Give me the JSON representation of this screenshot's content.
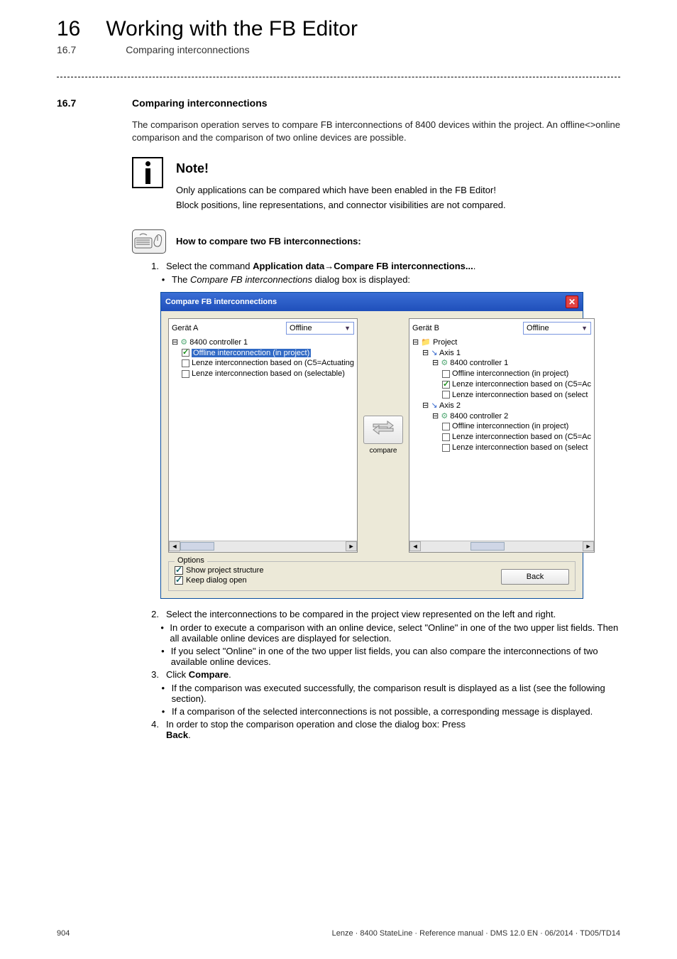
{
  "header": {
    "chapter_num": "16",
    "chapter_title": "Working with the FB Editor",
    "section_ref": "16.7",
    "section_ref_title": "Comparing interconnections"
  },
  "section": {
    "num": "16.7",
    "title": "Comparing interconnections",
    "intro": "The comparison operation serves to compare FB interconnections of 8400 devices within the project. An offline<>online comparison and the comparison of two online devices are possible."
  },
  "note": {
    "title": "Note!",
    "line1": "Only applications can be compared which have been enabled in the FB Editor!",
    "line2": "Block positions, line representations, and connector visibilities are not compared."
  },
  "howto": {
    "label": "How to compare two FB interconnections:"
  },
  "steps": {
    "s1_pre": "Select the command ",
    "s1_b1": "Application data",
    "s1_arrow": "→",
    "s1_b2": "Compare FB interconnections...",
    "s1_post": ".",
    "s1_bullet_pre": "The ",
    "s1_bullet_i": "Compare FB interconnections",
    "s1_bullet_post": " dialog box is displayed:",
    "s2": "Select the interconnections to be compared in the project view represented on the left and right.",
    "s2_b1": "In order to execute a comparison with an online device, select \"Online\" in one of the two upper list fields. Then all available online devices are displayed for selection.",
    "s2_b2": "If you select \"Online\" in one of the two upper list fields, you can also compare the interconnections of two available online devices.",
    "s3_pre": "Click ",
    "s3_b": "Compare",
    "s3_post": ".",
    "s3_b1": "If the comparison was executed successfully, the comparison result is displayed as a list (see the following section).",
    "s3_b2": "If a comparison of the selected interconnections is not possible, a corresponding message is displayed.",
    "s4_pre": "In order to stop the comparison operation and close the dialog box: Press ",
    "s4_b": "Back",
    "s4_post": "."
  },
  "dialog": {
    "title": "Compare FB interconnections",
    "geratA": "Gerät A",
    "geratB": "Gerät B",
    "offline": "Offline",
    "compare_btn": "compare",
    "treeA": {
      "root": "8400 controller 1",
      "i1": "Offline interconnection (in project)",
      "i2": "Lenze interconnection based on (C5=Actuating",
      "i3": "Lenze interconnection based on (selectable)"
    },
    "treeB": {
      "project": "Project",
      "axis1": "Axis 1",
      "ctrl1": "8400 controller 1",
      "c1_i1": "Offline interconnection (in project)",
      "c1_i2": "Lenze interconnection based on (C5=Ac",
      "c1_i3": "Lenze interconnection based on (select",
      "axis2": "Axis 2",
      "ctrl2": "8400 controller 2",
      "c2_i1": "Offline interconnection (in project)",
      "c2_i2": "Lenze interconnection based on (C5=Ac",
      "c2_i3": "Lenze interconnection based on (select"
    },
    "options": {
      "title": "Options",
      "o1": "Show project structure",
      "o2": "Keep dialog open"
    },
    "back": "Back"
  },
  "footer": {
    "page": "904",
    "meta": "Lenze · 8400 StateLine · Reference manual · DMS 12.0 EN · 06/2014 · TD05/TD14"
  }
}
